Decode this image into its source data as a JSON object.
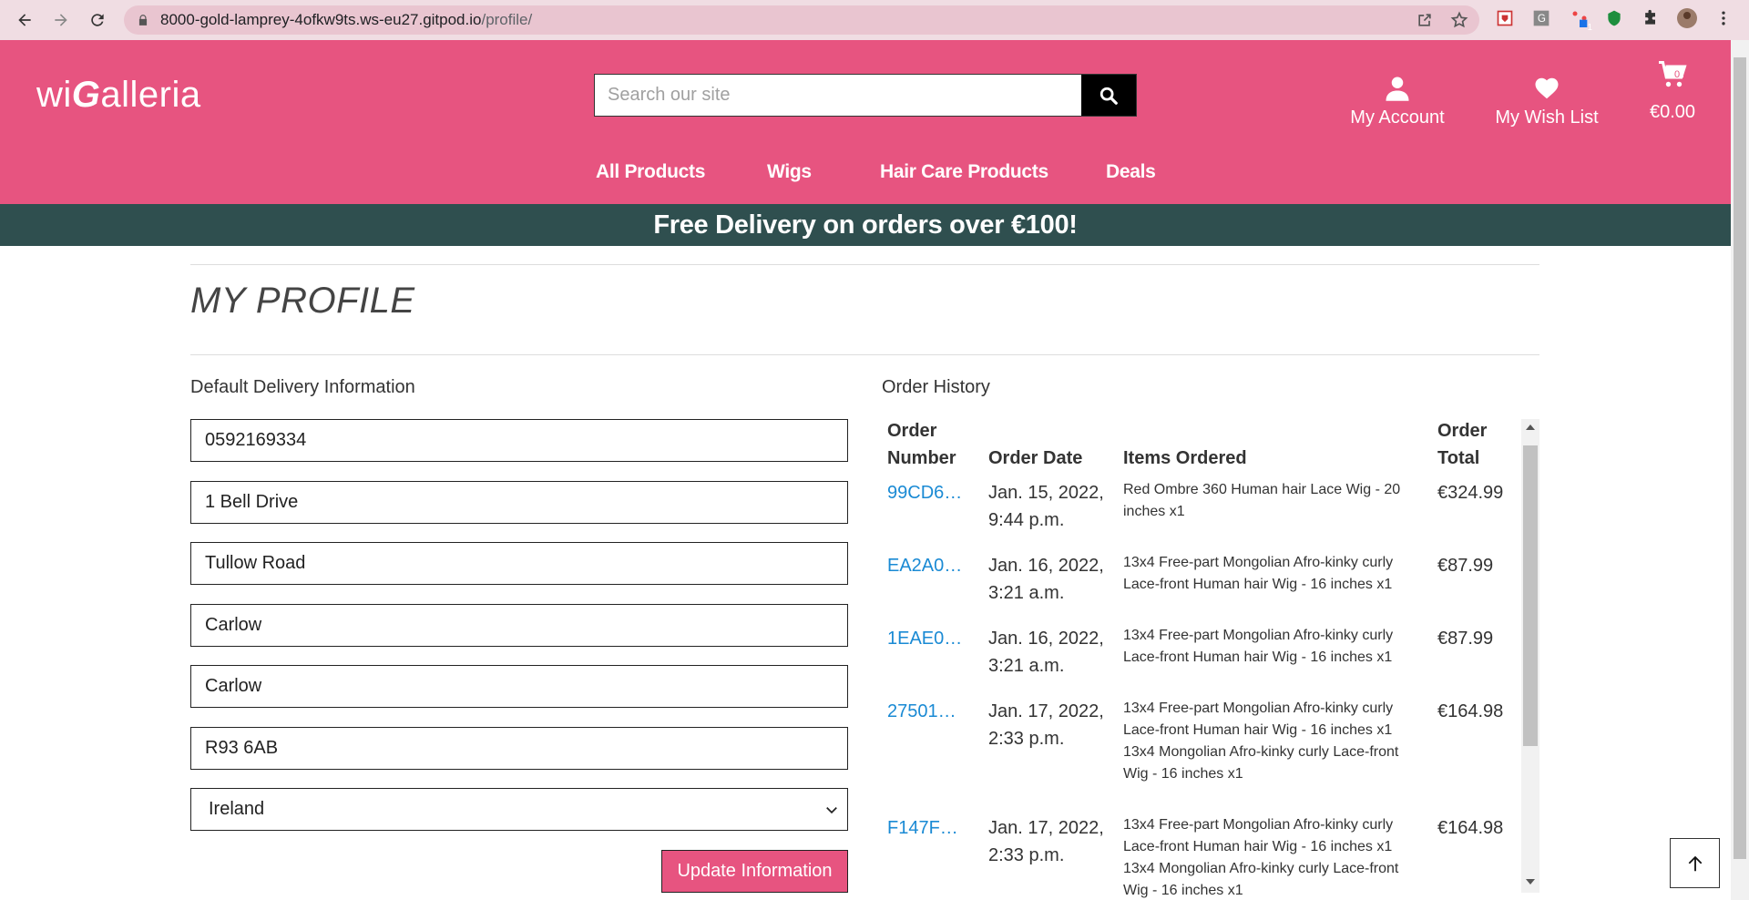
{
  "browser": {
    "url_host": "8000-gold-lamprey-4ofkw9ts.ws-eu27.gitpod.io",
    "url_path": "/profile/",
    "ext_badge": "1"
  },
  "header": {
    "logo_pre": "wi",
    "logo_g": "G",
    "logo_post": "alleria",
    "search_placeholder": "Search our site",
    "my_account": "My Account",
    "wish_list": "My Wish List",
    "cart_total": "€0.00",
    "cart_count": "0"
  },
  "nav": {
    "all_products": "All Products",
    "wigs": "Wigs",
    "hair_care": "Hair Care Products",
    "deals": "Deals"
  },
  "banner": "Free Delivery on orders over €100!",
  "profile": {
    "title": "MY PROFILE",
    "delivery_label": "Default Delivery Information",
    "fields": {
      "phone": "0592169334",
      "street1": "1 Bell Drive",
      "street2": "Tullow Road",
      "town": "Carlow",
      "county": "Carlow",
      "postcode": "R93 6AB",
      "country": "Ireland"
    },
    "update_button": "Update Information"
  },
  "orders": {
    "label": "Order History",
    "headers": {
      "number_1": "Order",
      "number_2": "Number",
      "date": "Order Date",
      "items": "Items Ordered",
      "total_1": "Order",
      "total_2": "Total"
    },
    "rows": [
      {
        "number": "99CD6…",
        "date_1": "Jan. 15, 2022,",
        "date_2": "9:44 p.m.",
        "items": [
          "Red Ombre 360 Human hair Lace Wig - 20 inches x1"
        ],
        "total": "€324.99"
      },
      {
        "number": "EA2A0…",
        "date_1": "Jan. 16, 2022,",
        "date_2": "3:21 a.m.",
        "items": [
          "13x4 Free-part Mongolian Afro-kinky curly Lace-front Human hair Wig - 16 inches x1"
        ],
        "total": "€87.99"
      },
      {
        "number": "1EAE0…",
        "date_1": "Jan. 16, 2022,",
        "date_2": "3:21 a.m.",
        "items": [
          "13x4 Free-part Mongolian Afro-kinky curly Lace-front Human hair Wig - 16 inches x1"
        ],
        "total": "€87.99"
      },
      {
        "number": "27501…",
        "date_1": "Jan. 17, 2022,",
        "date_2": "2:33 p.m.",
        "items": [
          "13x4 Free-part Mongolian Afro-kinky curly Lace-front Human hair Wig - 16 inches x1",
          "13x4 Mongolian Afro-kinky curly Lace-front Wig - 16 inches x1"
        ],
        "total": "€164.98"
      },
      {
        "number": "F147F…",
        "date_1": "Jan. 17, 2022,",
        "date_2": "2:33 p.m.",
        "items": [
          "13x4 Free-part Mongolian Afro-kinky curly Lace-front Human hair Wig - 16 inches x1",
          "13x4 Mongolian Afro-kinky curly Lace-front Wig - 16 inches x1"
        ],
        "total": "€164.98"
      }
    ]
  },
  "colors": {
    "brand_pink": "#e75480",
    "banner_dark": "#2f4f4f",
    "link_blue": "#1a8ad4"
  }
}
